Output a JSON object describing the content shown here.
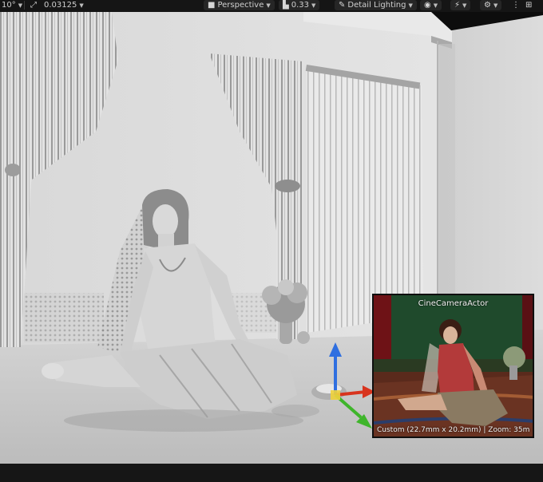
{
  "toolbar": {
    "angle_value": "10°",
    "scale_value": "0.03125",
    "view_mode": "Perspective",
    "camera_speed": "0.33",
    "lighting_mode": "Detail Lighting",
    "icons": [
      "angle-snap-icon",
      "scale-snap-icon",
      "perspective-camera-icon",
      "camera-speed-icon",
      "lighting-mode-icon",
      "show-eye-icon",
      "realtime-icon",
      "settings-gear-icon",
      "more-icon",
      "layout-grid-icon"
    ]
  },
  "camera_preview": {
    "title": "CineCameraActor",
    "info": "Custom (22.7mm x 20.2mm) | Zoom: 35m"
  },
  "colors": {
    "toolbar_bg": "#151515",
    "gizmo_z": "#2f6fe0",
    "gizmo_x": "#d8341e",
    "gizmo_y": "#3fb52b"
  }
}
